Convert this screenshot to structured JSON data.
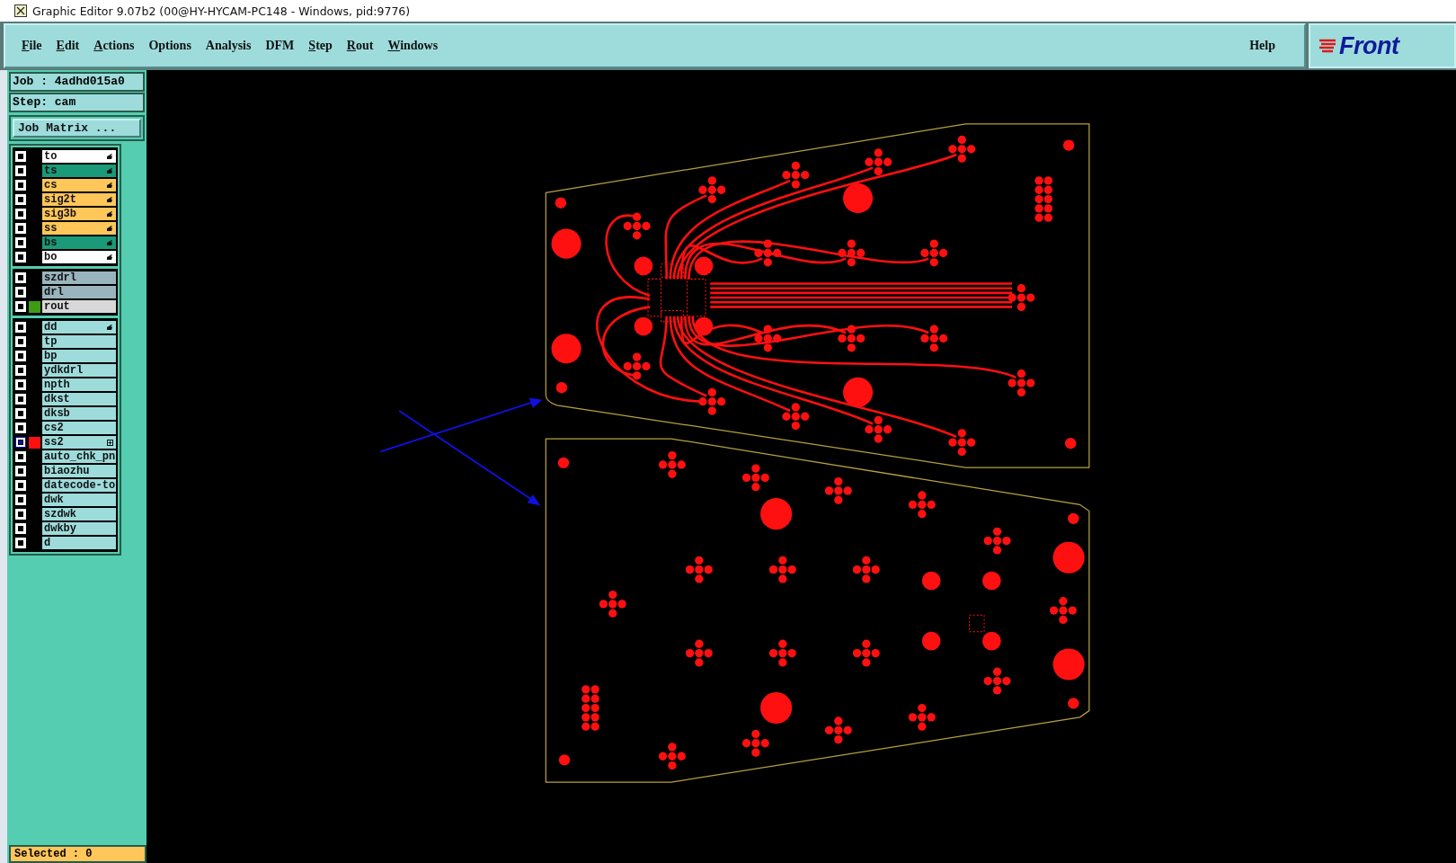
{
  "window": {
    "title": "Graphic Editor 9.07b2 (00@HY-HYCAM-PC148 - Windows, pid:9776)"
  },
  "menu": [
    {
      "label": "File",
      "underlined": true
    },
    {
      "label": "Edit",
      "underlined": true
    },
    {
      "label": "Actions",
      "underlined": true
    },
    {
      "label": "Options",
      "underlined": false
    },
    {
      "label": "Analysis",
      "underlined": false
    },
    {
      "label": "DFM",
      "underlined": false
    },
    {
      "label": "Step",
      "underlined": true
    },
    {
      "label": "Rout",
      "underlined": true
    },
    {
      "label": "Windows",
      "underlined": true
    }
  ],
  "help": "Help",
  "logo": "Front",
  "job": "Job : 4adhd015a0",
  "step": "Step: cam",
  "job_matrix_button": "Job Matrix ...",
  "layer_groups": [
    [
      {
        "name": "to",
        "kind": "silk",
        "affected": true,
        "selected": false
      },
      {
        "name": "ts",
        "kind": "mask",
        "affected": true,
        "selected": false
      },
      {
        "name": "cs",
        "kind": "signal",
        "affected": true,
        "selected": false
      },
      {
        "name": "sig2t",
        "kind": "signal",
        "affected": true,
        "selected": false
      },
      {
        "name": "sig3b",
        "kind": "signal",
        "affected": true,
        "selected": false
      },
      {
        "name": "ss",
        "kind": "signal",
        "affected": true,
        "selected": false
      },
      {
        "name": "bs",
        "kind": "mask",
        "affected": true,
        "selected": false
      },
      {
        "name": "bo",
        "kind": "silk",
        "affected": true,
        "selected": false
      }
    ],
    [
      {
        "name": "szdrl",
        "kind": "drill",
        "affected": false,
        "selected": false
      },
      {
        "name": "drl",
        "kind": "drill",
        "affected": false,
        "selected": false
      },
      {
        "name": "rout",
        "kind": "rout",
        "affected": false,
        "selected": false,
        "color": "#3c9c14"
      }
    ],
    [
      {
        "name": "dd",
        "kind": "misc",
        "affected": true,
        "selected": false
      },
      {
        "name": "tp",
        "kind": "misc",
        "affected": false,
        "selected": false
      },
      {
        "name": "bp",
        "kind": "misc",
        "affected": false,
        "selected": false
      },
      {
        "name": "ydkdrl",
        "kind": "misc",
        "affected": false,
        "selected": false
      },
      {
        "name": "npth",
        "kind": "misc",
        "affected": false,
        "selected": false
      },
      {
        "name": "dkst",
        "kind": "misc",
        "affected": false,
        "selected": false
      },
      {
        "name": "dksb",
        "kind": "misc",
        "affected": false,
        "selected": false
      },
      {
        "name": "cs2",
        "kind": "misc",
        "affected": false,
        "selected": false
      },
      {
        "name": "ss2",
        "kind": "misc",
        "affected": false,
        "selected": true,
        "color": "#ff1010",
        "expandable": true
      },
      {
        "name": "auto_chk_pn",
        "kind": "misc",
        "affected": false,
        "selected": false
      },
      {
        "name": "biaozhu",
        "kind": "misc",
        "affected": false,
        "selected": false
      },
      {
        "name": "datecode-to",
        "kind": "misc",
        "affected": false,
        "selected": false
      },
      {
        "name": "dwk",
        "kind": "misc",
        "affected": false,
        "selected": false
      },
      {
        "name": "szdwk",
        "kind": "misc",
        "affected": false,
        "selected": false
      },
      {
        "name": "dwkby",
        "kind": "misc",
        "affected": false,
        "selected": false
      },
      {
        "name": "d",
        "kind": "misc",
        "affected": false,
        "selected": false
      }
    ]
  ],
  "status": "Selected : 0"
}
